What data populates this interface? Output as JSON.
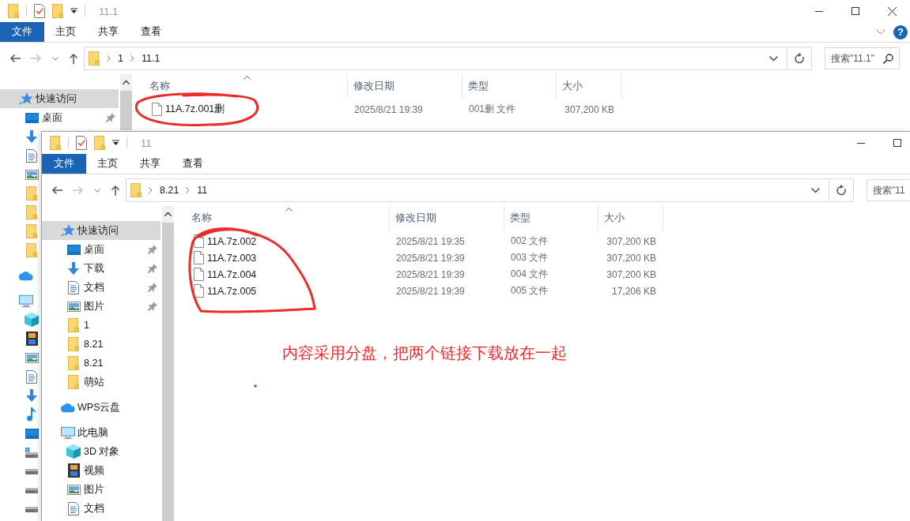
{
  "windows": [
    {
      "title": "11.1",
      "cut_right": false,
      "help": "?",
      "ribbon": {
        "file_tab": "文件",
        "tabs": [
          "主页",
          "共享",
          "查看"
        ]
      },
      "nav_buttons": {
        "forward_disabled": true
      },
      "address": {
        "crumbs": [
          "1",
          "11.1"
        ]
      },
      "search": {
        "placeholder": "搜索\"11.1\""
      },
      "nav": [
        {
          "kind": "quick",
          "label": "快速访问",
          "selected": true,
          "children": [
            {
              "kind": "desktop",
              "label": "桌面",
              "pinned": true,
              "selected": false
            },
            {
              "kind": "download",
              "selected": false
            },
            {
              "kind": "docs",
              "selected": false
            },
            {
              "kind": "pictures",
              "selected": false
            },
            {
              "kind": "folder",
              "selected": false
            },
            {
              "kind": "folder",
              "selected": false
            },
            {
              "kind": "folder",
              "selected": false
            },
            {
              "kind": "folder",
              "selected": false
            }
          ]
        },
        {
          "kind": "cloud",
          "selected": false
        },
        {
          "kind": "pc",
          "selected": false,
          "children": [
            {
              "kind": "cube",
              "selected": false
            },
            {
              "kind": "video",
              "selected": false
            },
            {
              "kind": "pictures",
              "selected": false
            },
            {
              "kind": "docs",
              "selected": false
            },
            {
              "kind": "download",
              "selected": false
            },
            {
              "kind": "music",
              "selected": false
            },
            {
              "kind": "desktop",
              "selected": false
            },
            {
              "kind": "systemdrive",
              "selected": false
            },
            {
              "kind": "drive",
              "selected": false
            },
            {
              "kind": "drive",
              "selected": false
            },
            {
              "kind": "drive",
              "selected": false
            }
          ]
        }
      ],
      "columns": [
        "名称",
        "修改日期",
        "类型",
        "大小"
      ],
      "rows": [
        {
          "name": "11A.7z.001删",
          "date": "2025/8/21 19:39",
          "type": "001删 文件",
          "size": "307,200 KB"
        }
      ]
    },
    {
      "title": "11",
      "cut_right": true,
      "ribbon": {
        "file_tab": "文件",
        "tabs": [
          "主页",
          "共享",
          "查看"
        ]
      },
      "nav_buttons": {
        "forward_disabled": true
      },
      "address": {
        "crumbs": [
          "8.21",
          "11"
        ]
      },
      "search": {
        "placeholder": "搜索\"11"
      },
      "nav": [
        {
          "kind": "quick",
          "label": "快速访问",
          "selected": true,
          "children": [
            {
              "kind": "desktop",
              "label": "桌面",
              "pinned": true,
              "selected": false
            },
            {
              "kind": "download",
              "label": "下载",
              "pinned": true,
              "selected": false
            },
            {
              "kind": "docs",
              "label": "文档",
              "pinned": true,
              "selected": false
            },
            {
              "kind": "pictures",
              "label": "图片",
              "pinned": true,
              "selected": false
            },
            {
              "kind": "folder",
              "label": "1",
              "pinned": false,
              "selected": false
            },
            {
              "kind": "folder",
              "label": "8.21",
              "pinned": false,
              "selected": false
            },
            {
              "kind": "folder",
              "label": "8.21",
              "pinned": false,
              "selected": false
            },
            {
              "kind": "folder",
              "label": "萌站",
              "pinned": false,
              "selected": false
            }
          ]
        },
        {
          "kind": "cloud",
          "label": "WPS云盘",
          "selected": false
        },
        {
          "kind": "pc",
          "label": "此电脑",
          "selected": false,
          "children": [
            {
              "kind": "cube",
              "label": "3D 对象",
              "selected": false
            },
            {
              "kind": "video",
              "label": "视频",
              "selected": false
            },
            {
              "kind": "pictures",
              "label": "图片",
              "selected": false
            },
            {
              "kind": "docs",
              "label": "文档",
              "selected": false
            }
          ]
        }
      ],
      "columns": [
        "名称",
        "修改日期",
        "类型",
        "大小"
      ],
      "rows": [
        {
          "name": "11A.7z.002",
          "date": "2025/8/21 19:35",
          "type": "002 文件",
          "size": "307,200 KB"
        },
        {
          "name": "11A.7z.003",
          "date": "2025/8/21 19:39",
          "type": "003 文件",
          "size": "307,200 KB"
        },
        {
          "name": "11A.7z.004",
          "date": "2025/8/21 19:39",
          "type": "004 文件",
          "size": "307,200 KB"
        },
        {
          "name": "11A.7z.005",
          "date": "2025/8/21 19:39",
          "type": "005 文件",
          "size": "17,206 KB"
        }
      ]
    }
  ],
  "annotation": {
    "note": "内容采用分盘，把两个链接下载放在一起"
  }
}
